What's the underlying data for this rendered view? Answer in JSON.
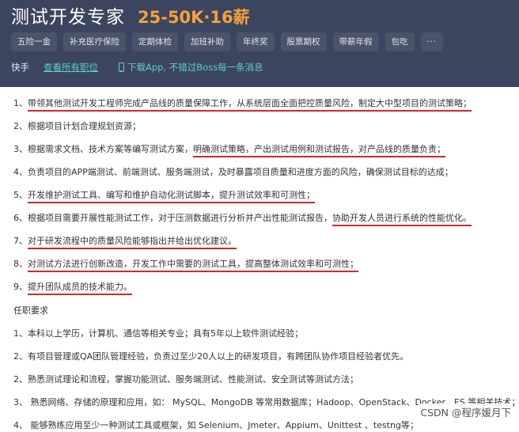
{
  "header": {
    "job_title": "测试开发专家",
    "salary": "25-50K·16薪",
    "tags": [
      "五险一金",
      "补充医疗保险",
      "定期体检",
      "加班补助",
      "年终奖",
      "股票期权",
      "带薪年假",
      "包吃"
    ],
    "more_label": "···",
    "share_label": "快手",
    "view_all_label": "查看所有职位",
    "download_label": "下载App, 不错过Boss每一条消息"
  },
  "duties": [
    {
      "pre": "1、",
      "ul": "带领其他测试开发工程师完成产品线的质量保障工作，从系统层面全面把控质量风险，制定大中型项目的测试策略；",
      "post": ""
    },
    {
      "pre": "2、根据项目计划合理规划资源；",
      "ul": "",
      "post": ""
    },
    {
      "pre": "3、根据需求文档、技术方案等编写测试方案，",
      "ul": "明确测试策略，产出测试用例和测试报告，对产品线的质量负责；",
      "post": ""
    },
    {
      "pre": "4、负责项目的APP端测试、前端测试、服务端测试，及时暴露项目质量和进度方面的风险，确保测试目标的达成；",
      "ul": "",
      "post": ""
    },
    {
      "pre": "5、",
      "ul": "开发维护测试工具、编写和维护自动化测试脚本，提升测试效率和可测性；",
      "post": ""
    },
    {
      "pre": "6、根据项目需要开展性能测试工作，对于压测数据进行分析并产出性能测试报告，",
      "ul": "协助开发人员进行系统的性能优化。",
      "post": ""
    },
    {
      "pre": "7、",
      "ul": "对于研发流程中的质量风险能够指出并给出优化建议。",
      "post": ""
    },
    {
      "pre": "8、",
      "ul": "对测试方法进行创新改造，开发工作中需要的测试工具，提高整体测试效率和可测性；",
      "post": ""
    },
    {
      "pre": "9、",
      "ul": "提升团队成员的技术能力。",
      "post": ""
    }
  ],
  "requirements_title": "任职要求",
  "requirements": [
    "1、本科以上学历，计算机、通信等相关专业；具有5年以上软件测试经验；",
    "2、有项目管理或QA团队管理经验，负责过至少20人以上的研发项目，有跨团队协作项目经验者优先。",
    "2、熟悉测试理论和流程，掌握功能测试、服务端测试、性能测试、安全测试等测试方法；",
    "3、 熟悉网络、存储的原理和应用，如： MySQL、MongoDB 等常用数据库；Hadoop、OpenStack、Docker、ES 等相关技术；",
    "4、 能够熟练应用至少一种测试工具或框架，如 Selenium、Jmeter、Appium、Unittest 、testng等；"
  ],
  "watermark": "CSDN @程序媛月下"
}
